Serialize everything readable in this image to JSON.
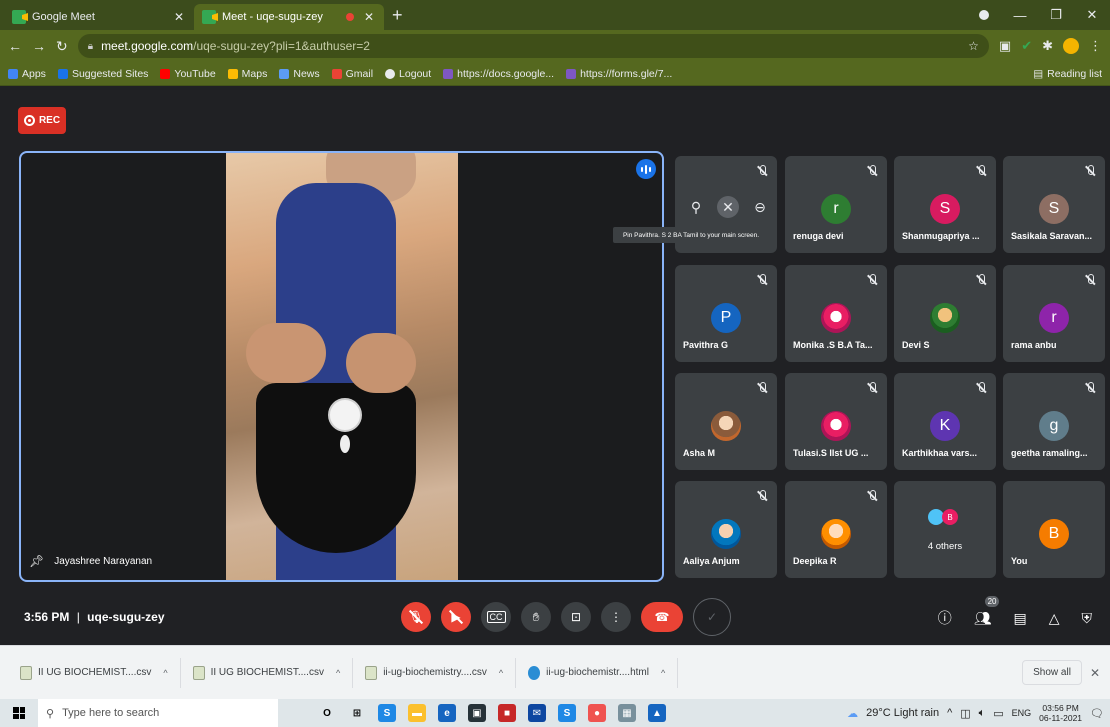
{
  "browser": {
    "tabs": [
      {
        "title": "Google Meet",
        "active": false
      },
      {
        "title": "Meet - uqe-sugu-zey",
        "active": true
      }
    ],
    "url_host": "meet.google.com",
    "url_path": "/uqe-sugu-zey?pli=1&authuser=2",
    "bookmarks": [
      "Apps",
      "Suggested Sites",
      "YouTube",
      "Maps",
      "News",
      "Gmail",
      "Logout",
      "https://docs.google...",
      "https://forms.gle/7..."
    ],
    "reading_list": "Reading list",
    "colors": {
      "frame": "#55681f",
      "tabstrip": "#3c4c1c"
    }
  },
  "meet": {
    "rec_label": "REC",
    "main_name": "Jayashree Narayanan",
    "tooltip": "Pin Pavithra. S 2 BA Tamil to your main screen.",
    "tiles": [
      {
        "name": "",
        "initial": "",
        "color": "",
        "kind": "hover"
      },
      {
        "name": "renuga devi",
        "initial": "r",
        "color": "#2e7d32",
        "kind": "letter"
      },
      {
        "name": "Shanmugapriya ...",
        "initial": "S",
        "color": "#d81b60",
        "kind": "letter"
      },
      {
        "name": "Sasikala Saravan...",
        "initial": "S",
        "color": "#8d6e63",
        "kind": "letter"
      },
      {
        "name": "Pavithra G",
        "initial": "P",
        "color": "#1565c0",
        "kind": "letter"
      },
      {
        "name": "Monika .S B.A Ta...",
        "initial": "",
        "color": "",
        "kind": "photo2"
      },
      {
        "name": "Devi S",
        "initial": "",
        "color": "",
        "kind": "photo3"
      },
      {
        "name": "rama anbu",
        "initial": "r",
        "color": "#8e24aa",
        "kind": "letter"
      },
      {
        "name": "Asha M",
        "initial": "",
        "color": "",
        "kind": "photo"
      },
      {
        "name": "Tulasi.S IIst UG ...",
        "initial": "",
        "color": "",
        "kind": "photo2"
      },
      {
        "name": "Karthikhaa vars...",
        "initial": "K",
        "color": "#5e35b1",
        "kind": "letter"
      },
      {
        "name": "geetha ramaling...",
        "initial": "g",
        "color": "#607d8b",
        "kind": "letter"
      },
      {
        "name": "Aaliya Anjum",
        "initial": "",
        "color": "",
        "kind": "photo4"
      },
      {
        "name": "Deepika R",
        "initial": "",
        "color": "",
        "kind": "photo6"
      },
      {
        "name": "4 others",
        "initial": "B",
        "color": "#e91e63",
        "kind": "others"
      },
      {
        "name": "You",
        "initial": "B",
        "color": "#f57c00",
        "kind": "letter"
      }
    ],
    "time": "3:56 PM",
    "separator": "|",
    "meeting_code": "uqe-sugu-zey",
    "participant_count": "20"
  },
  "downloads": {
    "items": [
      "II UG BIOCHEMIST....csv",
      "II UG BIOCHEMIST....csv",
      "ii-ug-biochemistry....csv",
      "ii-ug-biochemistr....html"
    ],
    "show_all": "Show all"
  },
  "taskbar": {
    "search_placeholder": "Type here to search",
    "weather": "29°C  Light rain",
    "lang": "ENG",
    "time": "03:56 PM",
    "date": "06-11-2021"
  }
}
